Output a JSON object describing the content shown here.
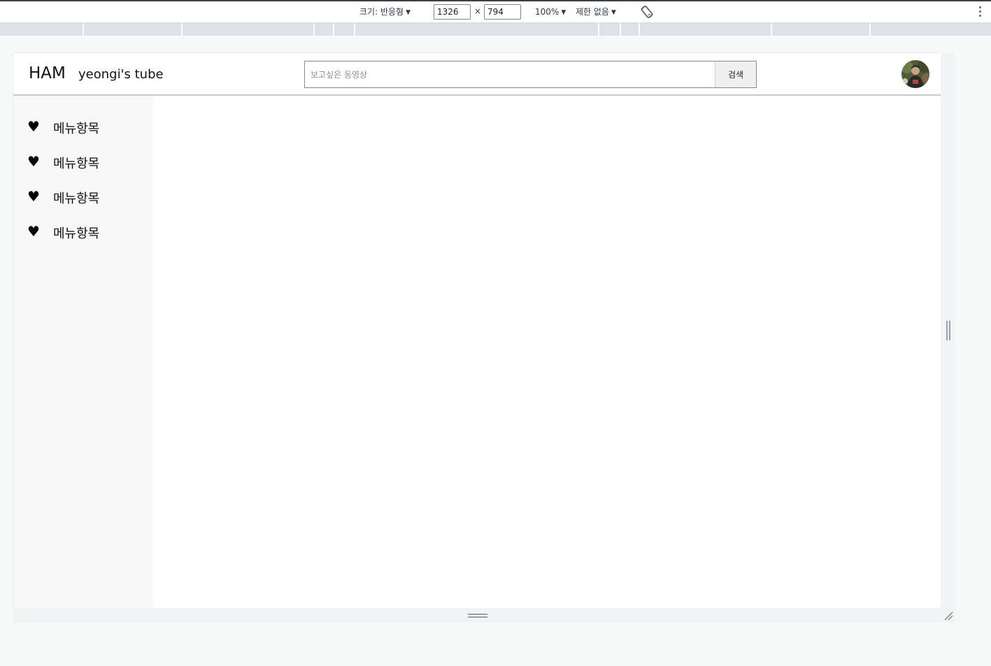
{
  "devtools": {
    "size_label": "크기: 반응형",
    "width_value": "1326",
    "height_value": "794",
    "times_sign": "×",
    "zoom_label": "100%",
    "throttle_label": "제한 없음",
    "caret": "▼"
  },
  "header": {
    "logo": "HAM",
    "site_title": "yeongi's tube",
    "search": {
      "placeholder": "보고싶은 동영상",
      "button_label": "검색"
    }
  },
  "sidebar": {
    "items": [
      {
        "icon": "♥",
        "label": "메뉴항목"
      },
      {
        "icon": "♥",
        "label": "메뉴항목"
      },
      {
        "icon": "♥",
        "label": "메뉴항목"
      },
      {
        "icon": "♥",
        "label": "메뉴항목"
      }
    ]
  },
  "icons": {
    "menu": "heart-icon",
    "rotate": "rotate-icon",
    "more": "more-vertical-icon",
    "profile": "avatar-image"
  },
  "colors": {
    "toolbar_bg": "#ffffff",
    "ruler_bg": "#dee1e6",
    "sidebar_bg": "#f8f8f8",
    "search_button_bg": "#efefef"
  }
}
